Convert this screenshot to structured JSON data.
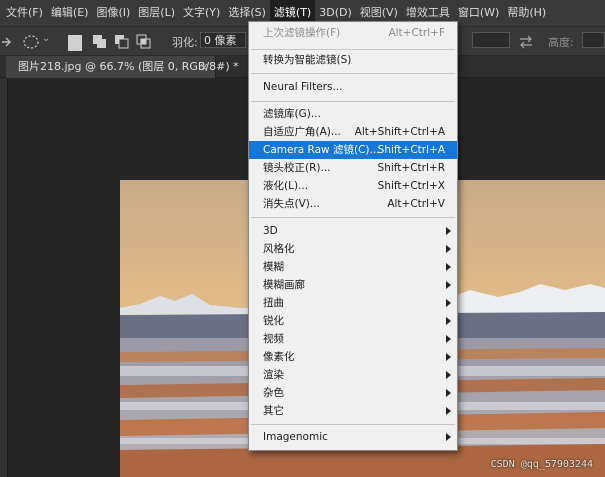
{
  "menubar": {
    "items": [
      {
        "label": "文件(F)"
      },
      {
        "label": "编辑(E)"
      },
      {
        "label": "图像(I)"
      },
      {
        "label": "图层(L)"
      },
      {
        "label": "文字(Y)"
      },
      {
        "label": "选择(S)"
      },
      {
        "label": "滤镜(T)"
      },
      {
        "label": "3D(D)"
      },
      {
        "label": "视图(V)"
      },
      {
        "label": "增效工具"
      },
      {
        "label": "窗口(W)"
      },
      {
        "label": "帮助(H)"
      }
    ],
    "active_index": 6
  },
  "options": {
    "feather_label": "羽化:",
    "feather_value": "0 像素",
    "height_label": "高度:"
  },
  "document": {
    "tab_label": "图片218.jpg @ 66.7% (图层 0, RGB/8#) *",
    "close_glyph": "×"
  },
  "filter_menu": {
    "last_filter": {
      "label": "上次滤镜操作(F)",
      "shortcut": "Alt+Ctrl+F"
    },
    "smart_filters": {
      "label": "转换为智能滤镜(S)"
    },
    "neural": {
      "label": "Neural Filters..."
    },
    "gallery": {
      "label": "滤镜库(G)..."
    },
    "adaptive_wide": {
      "label": "自适应广角(A)...",
      "shortcut": "Alt+Shift+Ctrl+A"
    },
    "camera_raw": {
      "label": "Camera Raw 滤镜(C)...",
      "shortcut": "Shift+Ctrl+A"
    },
    "lens_correction": {
      "label": "镜头校正(R)...",
      "shortcut": "Shift+Ctrl+R"
    },
    "liquify": {
      "label": "液化(L)...",
      "shortcut": "Shift+Ctrl+X"
    },
    "vanishing_point": {
      "label": "消失点(V)...",
      "shortcut": "Alt+Ctrl+V"
    },
    "submenus": [
      {
        "label": "3D"
      },
      {
        "label": "风格化"
      },
      {
        "label": "模糊"
      },
      {
        "label": "模糊画廊"
      },
      {
        "label": "扭曲"
      },
      {
        "label": "锐化"
      },
      {
        "label": "视频"
      },
      {
        "label": "像素化"
      },
      {
        "label": "渲染"
      },
      {
        "label": "杂色"
      },
      {
        "label": "其它"
      }
    ],
    "imagenomic": {
      "label": "Imagenomic"
    }
  },
  "watermark": "CSDN @qq_57903244",
  "colors": {
    "highlight": "#1577d6",
    "menu_bg": "#f0f0f0",
    "app_bg": "#262626"
  }
}
